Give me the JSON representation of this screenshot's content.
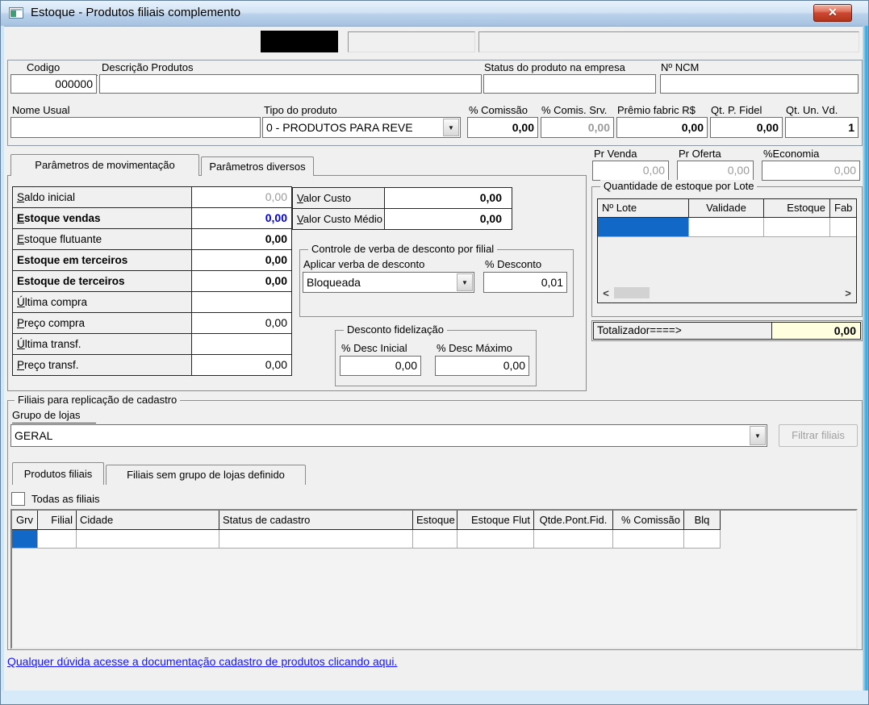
{
  "window": {
    "title": "Estoque - Produtos filiais complemento"
  },
  "icons": {
    "close": "✕",
    "dropdown": "▼",
    "scroll_left": "<",
    "scroll_right": ">"
  },
  "top": {
    "codigo_label": "Codigo",
    "codigo_value": "000000",
    "descricao_label": "Descrição  Produtos",
    "descricao_value": "",
    "status_label": "Status do produto na empresa",
    "status_value": "",
    "ncm_label": "Nº NCM",
    "ncm_value": "",
    "nome_usual_label": "Nome Usual",
    "nome_usual_value": "",
    "tipo_label": "Tipo do produto",
    "tipo_value": "0 - PRODUTOS PARA REVE",
    "comissao_label": "% Comissão",
    "comissao_value": "0,00",
    "comis_srv_label": "% Comis. Srv.",
    "comis_srv_value": "0,00",
    "premio_label": "Prêmio fabric R$",
    "premio_value": "0,00",
    "qt_fidel_label": "Qt. P. Fidel",
    "qt_fidel_value": "0,00",
    "qt_un_label": "Qt. Un. Vd.",
    "qt_un_value": "1"
  },
  "precos": {
    "pr_venda_label": "Pr Venda",
    "pr_venda_value": "0,00",
    "pr_oferta_label": "Pr Oferta",
    "pr_oferta_value": "0,00",
    "economia_label": "%Economia",
    "economia_value": "0,00"
  },
  "tabs_param": {
    "tab1": "Parâmetros de movimentação",
    "tab2": "Parâmetros diversos"
  },
  "mov": {
    "rows": [
      {
        "label": "Saldo inicial",
        "value": "0,00"
      },
      {
        "label": "Estoque vendas",
        "value": "0,00"
      },
      {
        "label": "Estoque flutuante",
        "value": "0,00"
      },
      {
        "label": "Estoque em terceiros",
        "value": "0,00"
      },
      {
        "label": "Estoque de terceiros",
        "value": "0,00"
      },
      {
        "label": "Última compra",
        "value": ""
      },
      {
        "label": "Preço compra",
        "value": "0,00"
      },
      {
        "label": "Última transf.",
        "value": ""
      },
      {
        "label": "Preço transf.",
        "value": "0,00"
      }
    ]
  },
  "custo": {
    "rows": [
      {
        "label": "Valor Custo",
        "value": "0,00"
      },
      {
        "label": "Valor Custo Médio",
        "value": "0,00"
      }
    ]
  },
  "verba": {
    "title": "Controle de verba de desconto por filial",
    "aplicar_label": "Aplicar verba de desconto",
    "aplicar_value": "Bloqueada",
    "desconto_label": "% Desconto",
    "desconto_value": "0,01"
  },
  "fidelizacao": {
    "title": "Desconto fidelização",
    "inicial_label": "% Desc Inicial",
    "inicial_value": "0,00",
    "maximo_label": "% Desc Máximo",
    "maximo_value": "0,00"
  },
  "lote": {
    "title": "Quantidade de estoque por Lote",
    "headers": [
      "Nº Lote",
      "Validade",
      "Estoque",
      "Fab"
    ],
    "totalizador_label": "Totalizador====>",
    "totalizador_value": "0,00"
  },
  "filiais": {
    "title": "Filiais para replicação de cadastro",
    "grupo_label": "Grupo de lojas",
    "grupo_value": "GERAL",
    "filtrar_button": "Filtrar filiais",
    "tab1": "Produtos filiais",
    "tab2": "Filiais sem grupo de lojas definido",
    "todas_label": "Todas as filiais",
    "headers": [
      "Grv",
      "Filial",
      "Cidade",
      "Status de cadastro",
      "Estoque",
      "Estoque Flut",
      "Qtde.Pont.Fid.",
      "% Comissão",
      "Blq"
    ]
  },
  "footer": {
    "link": "Qualquer dúvida acesse a documentação cadastro de produtos clicando aqui."
  }
}
